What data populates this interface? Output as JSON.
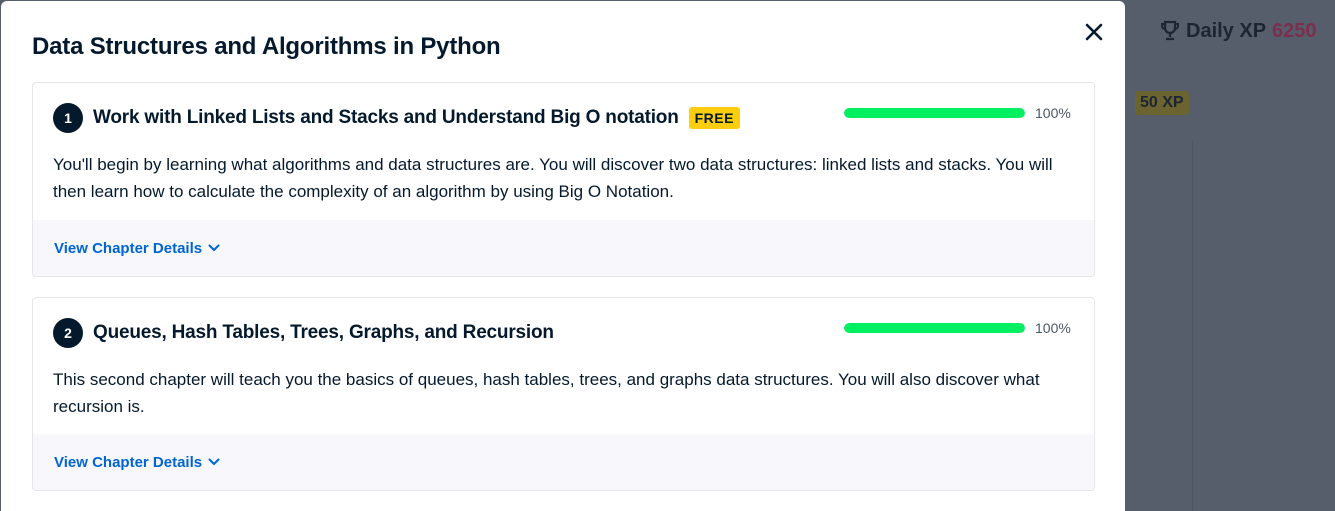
{
  "background": {
    "daily_xp_label": "Daily XP",
    "daily_xp_value": "6250",
    "xp_badge": "50 XP"
  },
  "modal": {
    "title": "Data Structures and Algorithms in Python",
    "close_icon": "close-icon"
  },
  "chapters": [
    {
      "number": "1",
      "title": "Work with Linked Lists and Stacks and Understand Big O notation",
      "badge": "FREE",
      "progress": 1.0,
      "progress_label": "100%",
      "description": "You'll begin by learning what algorithms and data structures are. You will discover two data structures: linked lists and stacks. You will then learn how to calculate the complexity of an algorithm by using Big O Notation.",
      "details_label": "View Chapter Details"
    },
    {
      "number": "2",
      "title": "Queues, Hash Tables, Trees, Graphs, and Recursion",
      "progress": 1.0,
      "progress_label": "100%",
      "description": "This second chapter will teach you the basics of queues, hash tables, trees, and graphs data structures. You will also discover what recursion is.",
      "details_label": "View Chapter Details"
    }
  ],
  "colors": {
    "progress_fill": "#03ef62",
    "link": "#0065d1",
    "badge": "#fcce0d",
    "navy": "#05192d"
  }
}
